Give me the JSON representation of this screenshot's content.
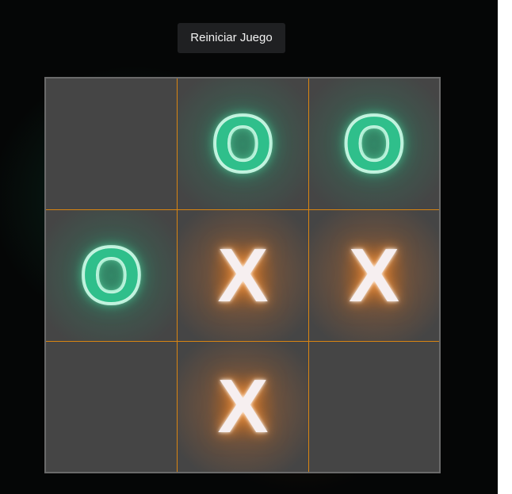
{
  "header": {
    "reset_label": "Reiniciar Juego"
  },
  "board": {
    "cells": [
      {
        "row": 0,
        "col": 0,
        "value": ""
      },
      {
        "row": 0,
        "col": 1,
        "value": "O"
      },
      {
        "row": 0,
        "col": 2,
        "value": "O"
      },
      {
        "row": 1,
        "col": 0,
        "value": "O"
      },
      {
        "row": 1,
        "col": 1,
        "value": "X"
      },
      {
        "row": 1,
        "col": 2,
        "value": "X"
      },
      {
        "row": 2,
        "col": 0,
        "value": ""
      },
      {
        "row": 2,
        "col": 1,
        "value": "X"
      },
      {
        "row": 2,
        "col": 2,
        "value": ""
      }
    ]
  },
  "colors": {
    "background": "#050606",
    "board": "#454545",
    "grid_line": "#d98512",
    "o_glow": "#2fbf8b",
    "x_glow": "#e07a1e",
    "button_bg": "#1f2022"
  }
}
